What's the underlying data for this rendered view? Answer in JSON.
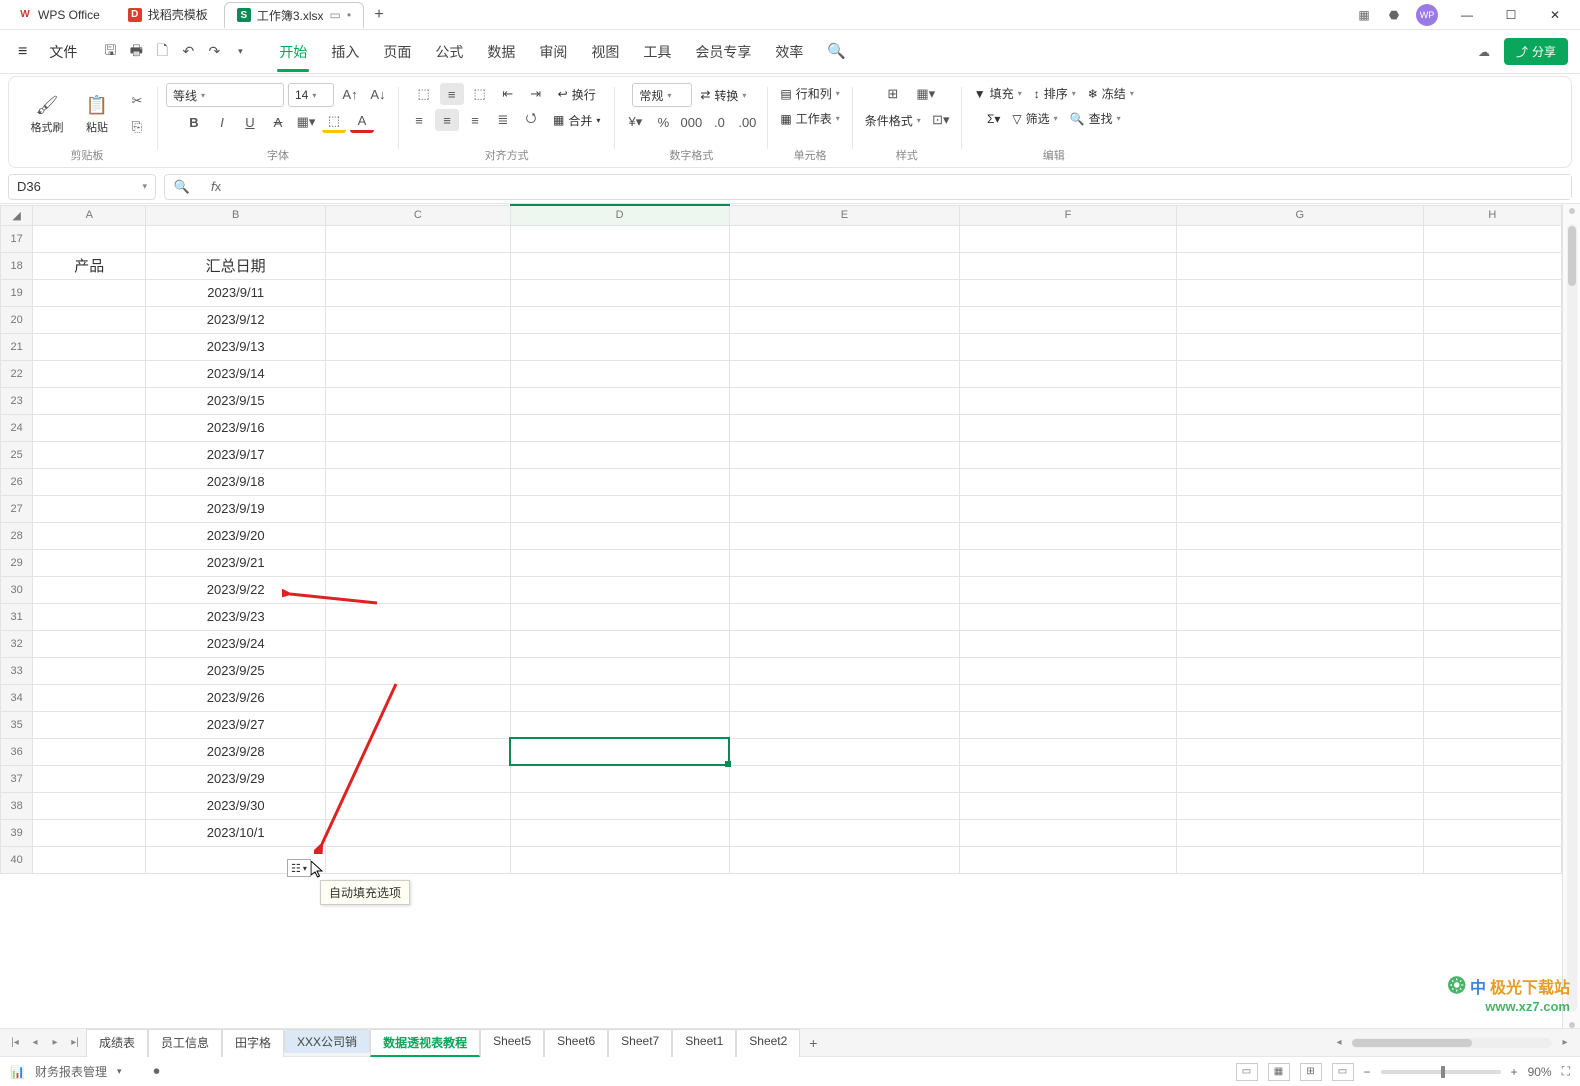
{
  "tabs": {
    "wps": "WPS Office",
    "template": "找稻壳模板",
    "file": "工作簿3.xlsx"
  },
  "avatar": "WP",
  "menu": {
    "file": "文件",
    "items": [
      "开始",
      "插入",
      "页面",
      "公式",
      "数据",
      "审阅",
      "视图",
      "工具",
      "会员专享",
      "效率"
    ],
    "share": "分享"
  },
  "ribbon": {
    "clipboard": {
      "fmt": "格式刷",
      "paste": "粘贴",
      "label": "剪贴板"
    },
    "font": {
      "name": "等线",
      "size": "14",
      "label": "字体"
    },
    "align": {
      "wrap": "换行",
      "merge": "合并",
      "label": "对齐方式"
    },
    "number": {
      "fmt": "常规",
      "convert": "转换",
      "label": "数字格式"
    },
    "cells": {
      "rowcol": "行和列",
      "sheet": "工作表",
      "label": "单元格"
    },
    "style": {
      "cond": "条件格式",
      "label": "样式"
    },
    "edit": {
      "fill": "填充",
      "sort": "排序",
      "freeze": "冻结",
      "filter": "筛选",
      "find": "查找",
      "label": "编辑"
    }
  },
  "namebox": "D36",
  "columns": [
    "A",
    "B",
    "C",
    "D",
    "E",
    "F",
    "G",
    "H"
  ],
  "rowStart": 17,
  "rowEnd": 40,
  "headerRow": {
    "A": "产品",
    "B": "汇总日期"
  },
  "dates": [
    "2023/9/11",
    "2023/9/12",
    "2023/9/13",
    "2023/9/14",
    "2023/9/15",
    "2023/9/16",
    "2023/9/17",
    "2023/9/18",
    "2023/9/19",
    "2023/9/20",
    "2023/9/21",
    "2023/9/22",
    "2023/9/23",
    "2023/9/24",
    "2023/9/25",
    "2023/9/26",
    "2023/9/27",
    "2023/9/28",
    "2023/9/29",
    "2023/9/30",
    "2023/10/1"
  ],
  "tooltip": "自动填充选项",
  "sheetTabs": [
    "成绩表",
    "员工信息",
    "田字格",
    "XXX公司销",
    "数据透视表教程",
    "Sheet5",
    "Sheet6",
    "Sheet7",
    "Sheet1",
    "Sheet2"
  ],
  "selectedSheetIndex": 3,
  "currentSheetIndex": 4,
  "status": {
    "mgmt": "财务报表管理",
    "zoom": "90%"
  },
  "watermark": {
    "brand": "极光下载站",
    "url": "www.xz7.com"
  },
  "chinese_ime": "中"
}
